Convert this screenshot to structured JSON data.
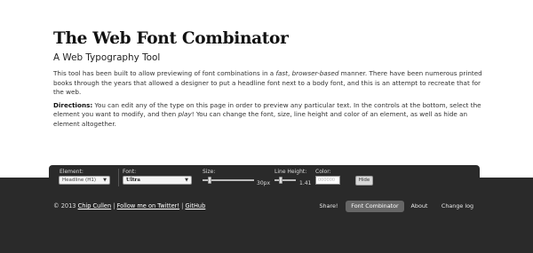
{
  "header": {
    "title": "The Web Font Combinator",
    "subtitle": "A Web Typography Tool"
  },
  "intro": {
    "p1_a": "This tool has been built to allow previewing of font combinations in a ",
    "p1_em1": "fast",
    "p1_b": ", ",
    "p1_em2": "browser-based",
    "p1_c": " manner. There have been numerous printed books through the years that allowed a designer to put a headline font next to a body font, and this is an attempt to recreate that for the web.",
    "p2_strong": "Directions:",
    "p2_a": " You can edit any of the type on this page in order to preview any particular text. In the controls at the bottom, select the element you want to modify, and then ",
    "p2_em": "play",
    "p2_b": "! You can change the font, size, line height and color of an element, as well as hide an element altogether."
  },
  "controls": {
    "element_label": "Element:",
    "element_value": "Headline (H1)",
    "font_label": "Font:",
    "font_value": "Ultra",
    "size_label": "Size:",
    "size_value": "30px",
    "size_level": 0.0,
    "line_height_label": "Line Height:",
    "line_height_value": "1.41",
    "color_label": "Color:",
    "color_placeholder": "000000",
    "hide_label": "Hide"
  },
  "footer": {
    "copyright": "© 2013",
    "author_link": "Chip Cullen",
    "sep1": " | ",
    "twitter_link": "Follow me on Twitter!",
    "sep2": " | ",
    "github_link": "GitHub",
    "nav": [
      "Share!",
      "Font Combinator",
      "About",
      "Change log"
    ],
    "active_nav": "Font Combinator"
  },
  "colors": {
    "footer_bg": "#2a2a2a",
    "active_nav_bg": "#666666"
  }
}
